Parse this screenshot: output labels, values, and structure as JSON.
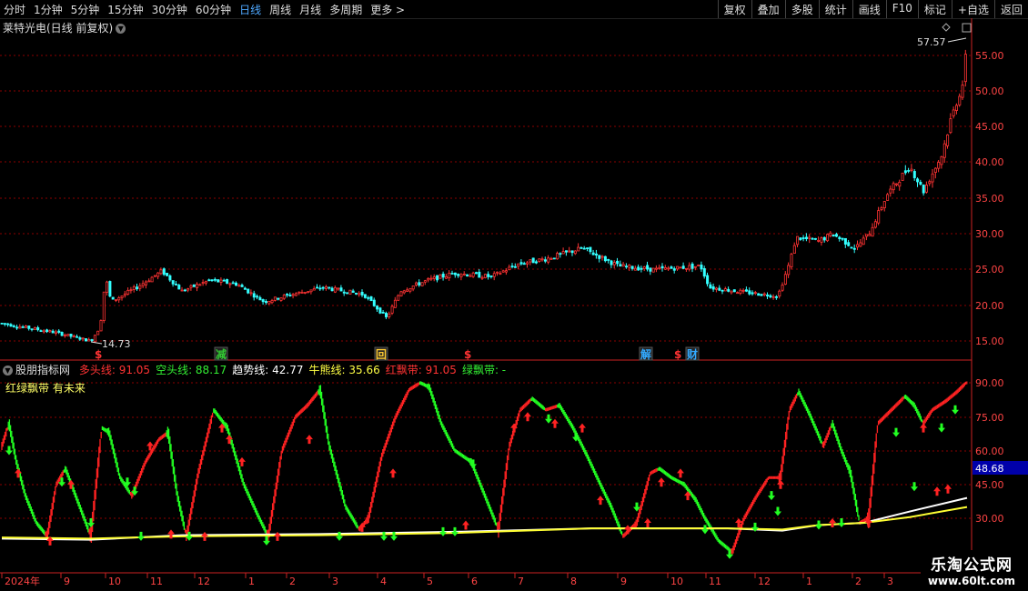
{
  "toolbar": {
    "periods": [
      "分时",
      "1分钟",
      "5分钟",
      "15分钟",
      "30分钟",
      "60分钟",
      "日线",
      "周线",
      "月线",
      "多周期",
      "更多 >"
    ],
    "active_period": "日线",
    "tools": [
      "复权",
      "叠加",
      "多股",
      "统计",
      "画线",
      "F10",
      "标记",
      "+自选",
      "返回"
    ]
  },
  "main": {
    "title": "莱特光电(日线 前复权)",
    "high_label": "57.57",
    "low_label": "14.73",
    "yticks": [
      "55.00",
      "50.00",
      "45.00",
      "40.00",
      "35.00",
      "30.00",
      "25.00",
      "20.00",
      "15.00"
    ],
    "event_tags": [
      {
        "text": "$",
        "color": "#ff3333"
      },
      {
        "text": "减",
        "color": "#33cc33"
      },
      {
        "text": "回",
        "color": "#ffcc33"
      },
      {
        "text": "$",
        "color": "#ff3333"
      },
      {
        "text": "解",
        "color": "#33aaff"
      },
      {
        "text": "$",
        "color": "#ff3333"
      },
      {
        "text": "财",
        "color": "#33aaff"
      }
    ]
  },
  "indicator": {
    "name": "股朋指标网",
    "fields": [
      {
        "label": "多头线: ",
        "value": "91.05",
        "color": "#ff3333"
      },
      {
        "label": "空头线: ",
        "value": "88.17",
        "color": "#33ee33"
      },
      {
        "label": "趋势线: ",
        "value": "42.77",
        "color": "#ffffff"
      },
      {
        "label": "牛熊线: ",
        "value": "35.66",
        "color": "#ffff44"
      },
      {
        "label": "红飘带: ",
        "value": "91.05",
        "color": "#ff3333"
      },
      {
        "label": "绿飘带: ",
        "value": "-",
        "color": "#33ee33"
      }
    ],
    "subtitle": "红绿飘带 有未来",
    "yticks": [
      "90.00",
      "75.00",
      "60.00",
      "45.00",
      "30.00"
    ],
    "current_value": "48.68"
  },
  "xaxis": {
    "labels": [
      "2024年",
      "9",
      "10",
      "11",
      "12",
      "1",
      "2",
      "3",
      "4",
      "5",
      "6",
      "7",
      "8",
      "9",
      "10",
      "11",
      "12",
      "1",
      "2",
      "3"
    ]
  },
  "watermark": {
    "line1": "乐淘公式网",
    "line2": "www.60lt.com"
  },
  "colors": {
    "up": "#ff3333",
    "down": "#33ffff",
    "grid": "#8b0000",
    "axis": "#cc2222"
  }
}
